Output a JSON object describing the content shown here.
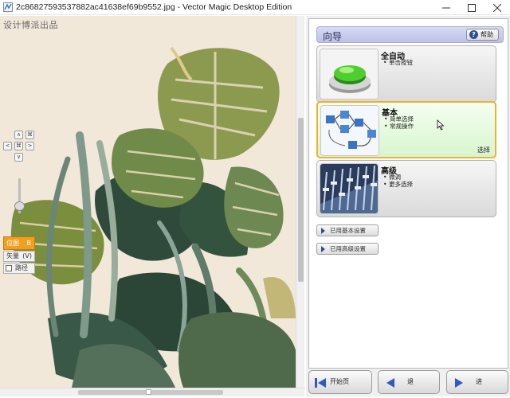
{
  "window": {
    "title": "2c8682759353788 2ac41638ef69b9552.jpg - Vector Magic Desktop Edition",
    "title_display": "2c86827593537882ac41638ef69b9552.jpg - Vector Magic Desktop Edition"
  },
  "canvas": {
    "watermark": "设计博派出品",
    "background_color": "#f1e8da"
  },
  "nav": {
    "up": "∧",
    "down": "∨",
    "left": "<",
    "right": ">",
    "center": "⌘",
    "fit": "⌘"
  },
  "view_modes": {
    "original_label": "位图",
    "original_key": "B",
    "vector_label": "矢量",
    "vector_key": "(V)",
    "path_label": "路径"
  },
  "panel": {
    "guide_title": "向导",
    "help_label": "帮助",
    "cards": [
      {
        "title": "全自动",
        "bullets": [
          "单击按钮"
        ],
        "selected": false
      },
      {
        "title": "基本",
        "bullets": [
          "简单选择",
          "常规操作"
        ],
        "selected": true,
        "select_label": "选择"
      },
      {
        "title": "高级",
        "bullets": [
          "微调",
          "更多选择"
        ],
        "selected": false
      }
    ],
    "basic_settings_label": "已用基本设置",
    "advanced_settings_label": "已用高级设置"
  },
  "bottom": {
    "start_label": "开始页",
    "back_label": "退",
    "next_label": "进"
  }
}
